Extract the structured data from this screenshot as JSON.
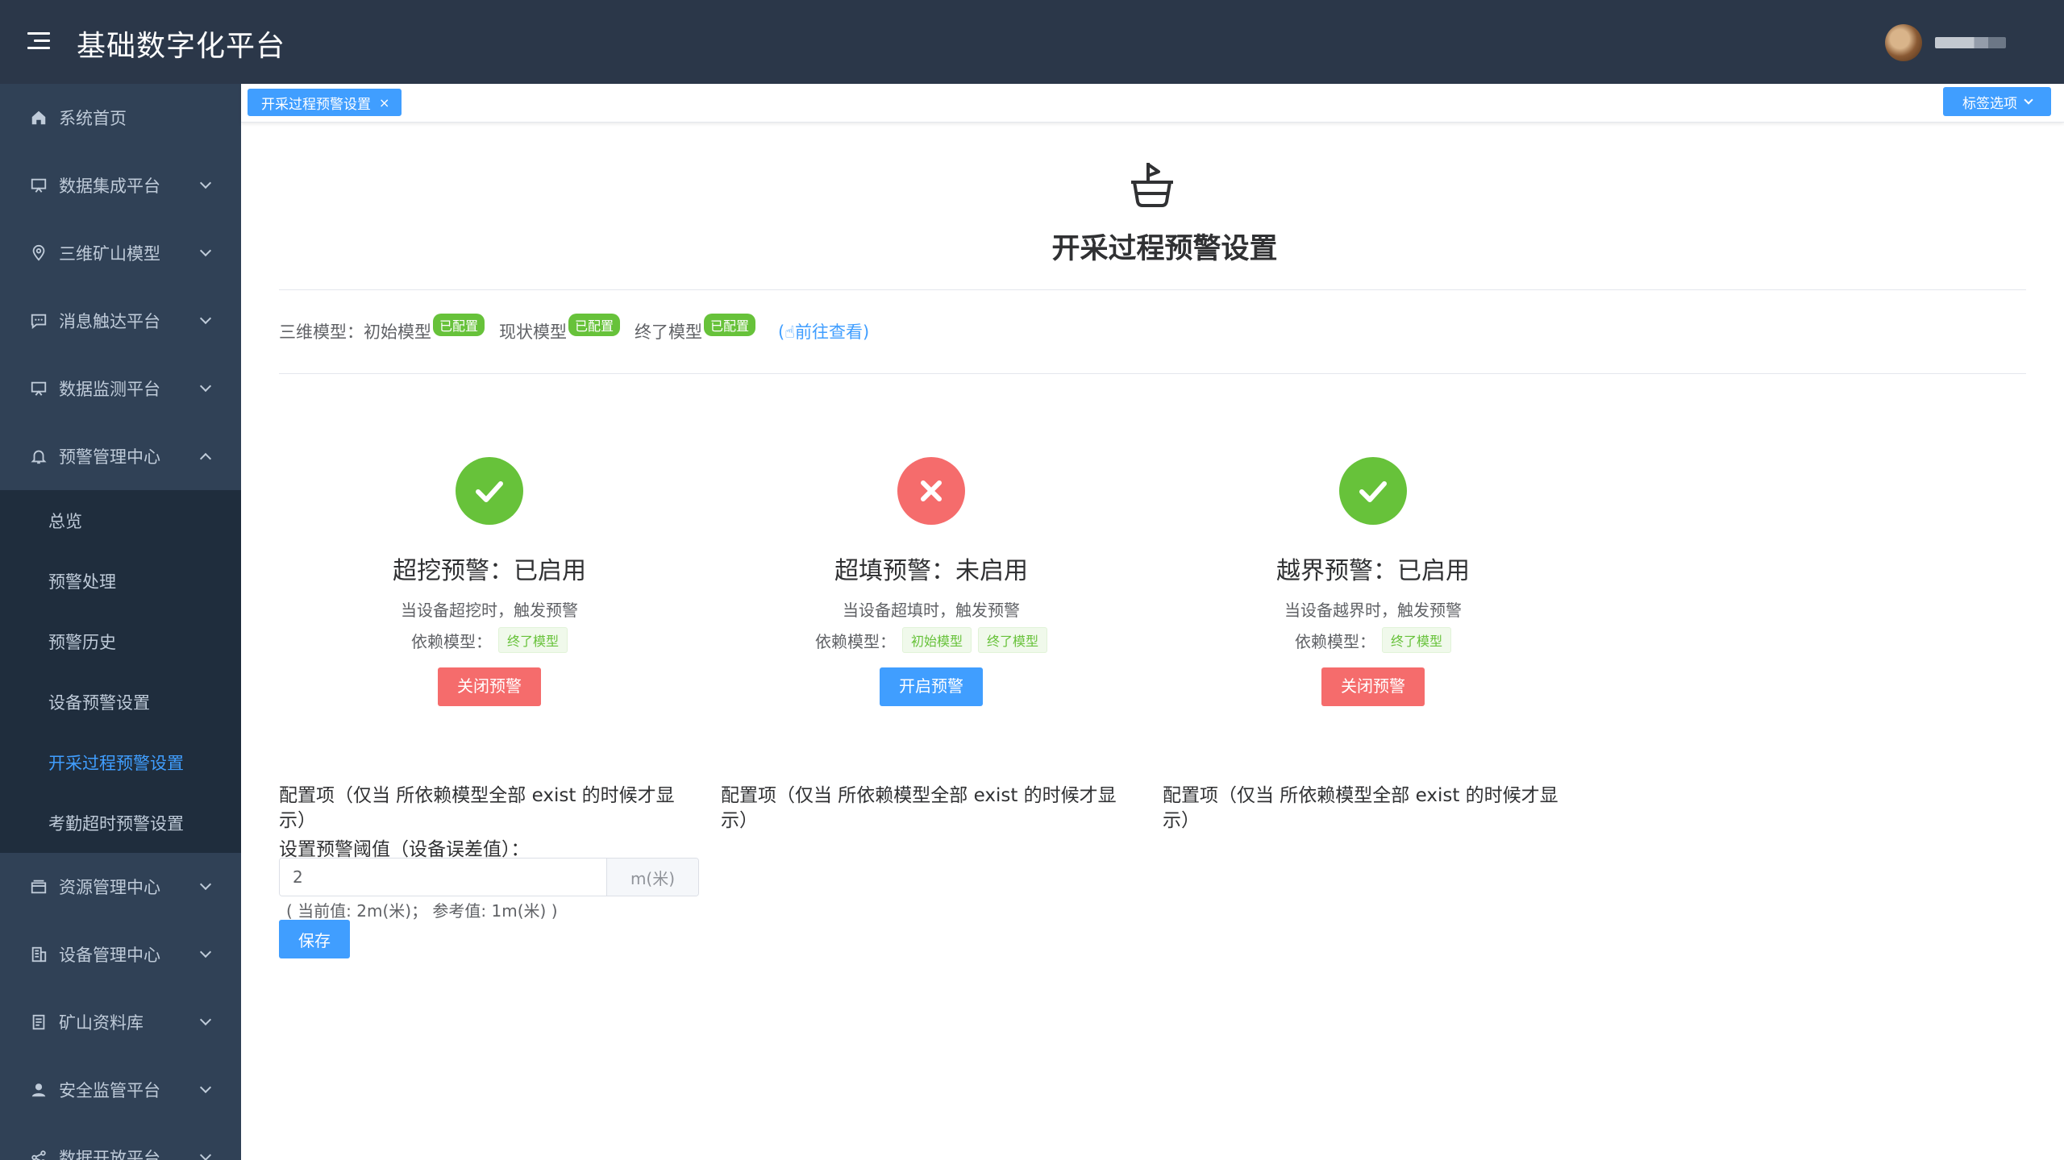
{
  "app": {
    "title": "基础数字化平台"
  },
  "sidebar": {
    "items": [
      {
        "label": "系统首页",
        "icon": "home-icon"
      },
      {
        "label": "数据集成平台",
        "icon": "monitor-icon"
      },
      {
        "label": "三维矿山模型",
        "icon": "location-icon"
      },
      {
        "label": "消息触达平台",
        "icon": "message-icon"
      },
      {
        "label": "数据监测平台",
        "icon": "monitor-icon"
      },
      {
        "label": "预警管理中心",
        "icon": "bell-icon"
      }
    ],
    "sub_items": [
      {
        "label": "总览"
      },
      {
        "label": "预警处理"
      },
      {
        "label": "预警历史"
      },
      {
        "label": "设备预警设置"
      },
      {
        "label": "开采过程预警设置",
        "active": true
      },
      {
        "label": "考勤超时预警设置"
      }
    ],
    "items_after": [
      {
        "label": "资源管理中心",
        "icon": "box-icon"
      },
      {
        "label": "设备管理中心",
        "icon": "building-icon"
      },
      {
        "label": "矿山资料库",
        "icon": "document-icon"
      },
      {
        "label": "安全监管平台",
        "icon": "user-icon"
      },
      {
        "label": "数据开放平台",
        "icon": "share-icon"
      }
    ]
  },
  "tags": {
    "active_tag": "开采过程预警设置",
    "close": "×",
    "options_label": "标签选项"
  },
  "page": {
    "title": "开采过程预警设置",
    "models_prefix": "三维模型：",
    "models": [
      {
        "name": "初始模型",
        "status": "已配置"
      },
      {
        "name": "现状模型",
        "status": "已配置"
      },
      {
        "name": "终了模型",
        "status": "已配置"
      }
    ],
    "goto_link": "(☝前往查看)"
  },
  "warnings": [
    {
      "title": "超挖预警：已启用",
      "desc": "当设备超挖时，触发预警",
      "dep_label": "依赖模型：",
      "deps": [
        "终了模型"
      ],
      "button": "关闭预警",
      "enabled": true
    },
    {
      "title": "超填预警：未启用",
      "desc": "当设备超填时，触发预警",
      "dep_label": "依赖模型：",
      "deps": [
        "初始模型",
        "终了模型"
      ],
      "button": "开启预警",
      "enabled": false
    },
    {
      "title": "越界预警：已启用",
      "desc": "当设备越界时，触发预警",
      "dep_label": "依赖模型：",
      "deps": [
        "终了模型"
      ],
      "button": "关闭预警",
      "enabled": true
    }
  ],
  "config": {
    "note": "配置项（仅当 所依赖模型全部 exist 的时候才显示）",
    "threshold_label": "设置预警阈值（设备误差值）：",
    "threshold_value": "2",
    "unit": "m(米)",
    "hint": "( 当前值: 2m(米)；  参考值: 1m(米) )",
    "save": "保存"
  },
  "colors": {
    "primary": "#409eff",
    "success": "#67c23a",
    "danger": "#f56c6c",
    "sidebar_bg": "#304156",
    "topbar_bg": "#2b3749"
  }
}
